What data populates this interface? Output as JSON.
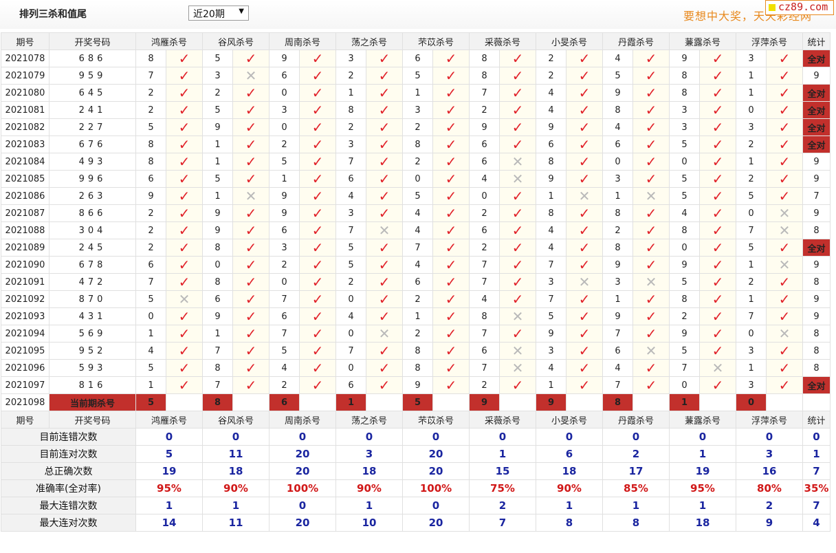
{
  "header": {
    "title": "排列三杀和值尾",
    "period_select": "近20期",
    "promo": "要想中大奖，天天彩经网",
    "logo": "cz89.com"
  },
  "columns": {
    "period": "期号",
    "numbers": "开奖号码",
    "experts": [
      "鸿雁杀号",
      "谷风杀号",
      "周南杀号",
      "荡之杀号",
      "芣苡杀号",
      "采薇杀号",
      "小旻杀号",
      "丹霞杀号",
      "蒹露杀号",
      "浮萍杀号"
    ],
    "stat": "统计"
  },
  "rows": [
    {
      "period": "2021078",
      "numbers": "686",
      "kills": [
        8,
        5,
        9,
        3,
        6,
        8,
        2,
        4,
        9,
        3
      ],
      "results": [
        1,
        1,
        1,
        1,
        1,
        1,
        1,
        1,
        1,
        1
      ],
      "stat": "全对"
    },
    {
      "period": "2021079",
      "numbers": "959",
      "kills": [
        7,
        3,
        6,
        2,
        5,
        8,
        2,
        5,
        8,
        1
      ],
      "results": [
        1,
        0,
        1,
        1,
        1,
        1,
        1,
        1,
        1,
        1
      ],
      "stat": "9"
    },
    {
      "period": "2021080",
      "numbers": "645",
      "kills": [
        2,
        2,
        0,
        1,
        1,
        7,
        4,
        9,
        8,
        1
      ],
      "results": [
        1,
        1,
        1,
        1,
        1,
        1,
        1,
        1,
        1,
        1
      ],
      "stat": "全对"
    },
    {
      "period": "2021081",
      "numbers": "241",
      "kills": [
        2,
        5,
        3,
        8,
        3,
        2,
        4,
        8,
        3,
        0
      ],
      "results": [
        1,
        1,
        1,
        1,
        1,
        1,
        1,
        1,
        1,
        1
      ],
      "stat": "全对"
    },
    {
      "period": "2021082",
      "numbers": "227",
      "kills": [
        5,
        9,
        0,
        2,
        2,
        9,
        9,
        4,
        3,
        3
      ],
      "results": [
        1,
        1,
        1,
        1,
        1,
        1,
        1,
        1,
        1,
        1
      ],
      "stat": "全对"
    },
    {
      "period": "2021083",
      "numbers": "676",
      "kills": [
        8,
        1,
        2,
        3,
        8,
        6,
        6,
        6,
        5,
        2
      ],
      "results": [
        1,
        1,
        1,
        1,
        1,
        1,
        1,
        1,
        1,
        1
      ],
      "stat": "全对"
    },
    {
      "period": "2021084",
      "numbers": "493",
      "kills": [
        8,
        1,
        5,
        7,
        2,
        6,
        8,
        0,
        0,
        1
      ],
      "results": [
        1,
        1,
        1,
        1,
        1,
        0,
        1,
        1,
        1,
        1
      ],
      "stat": "9"
    },
    {
      "period": "2021085",
      "numbers": "996",
      "kills": [
        6,
        5,
        1,
        6,
        0,
        4,
        9,
        3,
        5,
        2
      ],
      "results": [
        1,
        1,
        1,
        1,
        1,
        0,
        1,
        1,
        1,
        1
      ],
      "stat": "9"
    },
    {
      "period": "2021086",
      "numbers": "263",
      "kills": [
        9,
        1,
        9,
        4,
        5,
        0,
        1,
        1,
        5,
        5
      ],
      "results": [
        1,
        0,
        1,
        1,
        1,
        1,
        0,
        0,
        1,
        1
      ],
      "stat": "7"
    },
    {
      "period": "2021087",
      "numbers": "866",
      "kills": [
        2,
        9,
        9,
        3,
        4,
        2,
        8,
        8,
        4,
        0
      ],
      "results": [
        1,
        1,
        1,
        1,
        1,
        1,
        1,
        1,
        1,
        0
      ],
      "stat": "9"
    },
    {
      "period": "2021088",
      "numbers": "304",
      "kills": [
        2,
        9,
        6,
        7,
        4,
        6,
        4,
        2,
        8,
        7
      ],
      "results": [
        1,
        1,
        1,
        0,
        1,
        1,
        1,
        1,
        1,
        0
      ],
      "stat": "8"
    },
    {
      "period": "2021089",
      "numbers": "245",
      "kills": [
        2,
        8,
        3,
        5,
        7,
        2,
        4,
        8,
        0,
        5
      ],
      "results": [
        1,
        1,
        1,
        1,
        1,
        1,
        1,
        1,
        1,
        1
      ],
      "stat": "全对"
    },
    {
      "period": "2021090",
      "numbers": "678",
      "kills": [
        6,
        0,
        2,
        5,
        4,
        7,
        7,
        9,
        9,
        1
      ],
      "results": [
        1,
        1,
        1,
        1,
        1,
        1,
        1,
        1,
        1,
        0
      ],
      "stat": "9"
    },
    {
      "period": "2021091",
      "numbers": "472",
      "kills": [
        7,
        8,
        0,
        2,
        6,
        7,
        3,
        3,
        5,
        2
      ],
      "results": [
        1,
        1,
        1,
        1,
        1,
        1,
        0,
        0,
        1,
        1
      ],
      "stat": "8"
    },
    {
      "period": "2021092",
      "numbers": "870",
      "kills": [
        5,
        6,
        7,
        0,
        2,
        4,
        7,
        1,
        8,
        1
      ],
      "results": [
        0,
        1,
        1,
        1,
        1,
        1,
        1,
        1,
        1,
        1
      ],
      "stat": "9"
    },
    {
      "period": "2021093",
      "numbers": "431",
      "kills": [
        0,
        9,
        6,
        4,
        1,
        8,
        5,
        9,
        2,
        7
      ],
      "results": [
        1,
        1,
        1,
        1,
        1,
        0,
        1,
        1,
        1,
        1
      ],
      "stat": "9"
    },
    {
      "period": "2021094",
      "numbers": "569",
      "kills": [
        1,
        1,
        7,
        0,
        2,
        7,
        9,
        7,
        9,
        0
      ],
      "results": [
        1,
        1,
        1,
        0,
        1,
        1,
        1,
        1,
        1,
        0
      ],
      "stat": "8"
    },
    {
      "period": "2021095",
      "numbers": "952",
      "kills": [
        4,
        7,
        5,
        7,
        8,
        6,
        3,
        6,
        5,
        3
      ],
      "results": [
        1,
        1,
        1,
        1,
        1,
        0,
        1,
        0,
        1,
        1
      ],
      "stat": "8"
    },
    {
      "period": "2021096",
      "numbers": "593",
      "kills": [
        5,
        8,
        4,
        0,
        8,
        7,
        4,
        4,
        7,
        1
      ],
      "results": [
        1,
        1,
        1,
        1,
        1,
        0,
        1,
        1,
        0,
        1
      ],
      "stat": "8"
    },
    {
      "period": "2021097",
      "numbers": "816",
      "kills": [
        1,
        7,
        2,
        6,
        9,
        2,
        1,
        7,
        0,
        3
      ],
      "results": [
        1,
        1,
        1,
        1,
        1,
        1,
        1,
        1,
        1,
        1
      ],
      "stat": "全对"
    }
  ],
  "current": {
    "period": "2021098",
    "label": "当前期杀号",
    "kills": [
      5,
      8,
      6,
      1,
      5,
      9,
      9,
      8,
      1,
      0
    ]
  },
  "summary": [
    {
      "label": "目前连错次数",
      "values": [
        "0",
        "0",
        "0",
        "0",
        "0",
        "0",
        "0",
        "0",
        "0",
        "0"
      ],
      "stat": "0",
      "red": false
    },
    {
      "label": "目前连对次数",
      "values": [
        "5",
        "11",
        "20",
        "3",
        "20",
        "1",
        "6",
        "2",
        "1",
        "3"
      ],
      "stat": "1",
      "red": false
    },
    {
      "label": "总正确次数",
      "values": [
        "19",
        "18",
        "20",
        "18",
        "20",
        "15",
        "18",
        "17",
        "19",
        "16"
      ],
      "stat": "7",
      "red": false
    },
    {
      "label": "准确率(全对率)",
      "values": [
        "95%",
        "90%",
        "100%",
        "90%",
        "100%",
        "75%",
        "90%",
        "85%",
        "95%",
        "80%"
      ],
      "stat": "35%",
      "red": true
    },
    {
      "label": "最大连错次数",
      "values": [
        "1",
        "1",
        "0",
        "1",
        "0",
        "2",
        "1",
        "1",
        "1",
        "2"
      ],
      "stat": "7",
      "red": false
    },
    {
      "label": "最大连对次数",
      "values": [
        "14",
        "11",
        "20",
        "10",
        "20",
        "7",
        "8",
        "8",
        "18",
        "9"
      ],
      "stat": "4",
      "red": false
    }
  ],
  "icons": {
    "correct": "check-icon",
    "wrong": "cross-icon"
  },
  "colors": {
    "accent_red": "#c2302c",
    "check_red": "#e1222a",
    "summary_blue": "#1a25a0",
    "promo_orange": "#e8891e"
  }
}
